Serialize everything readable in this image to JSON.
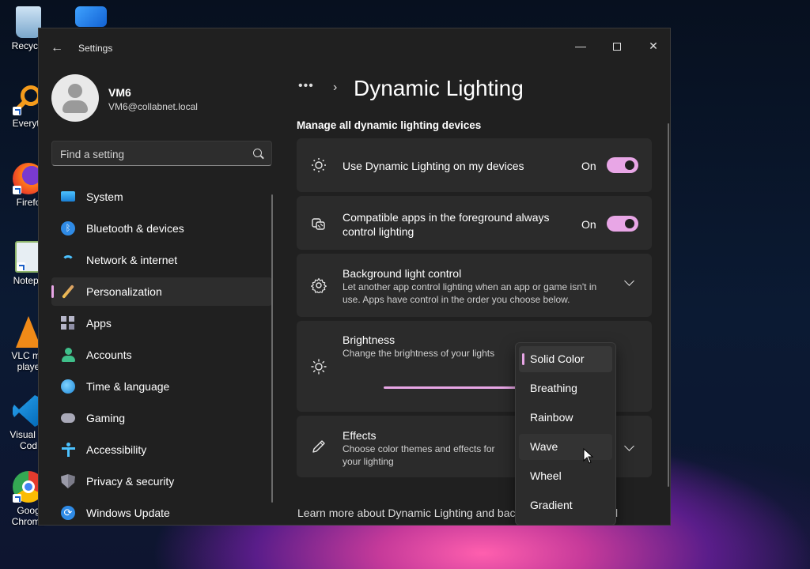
{
  "desktop": {
    "icons": [
      {
        "label": "Recycle",
        "icon": "recycle-bin-icon"
      },
      {
        "label": "Everyth",
        "icon": "everything-search-icon"
      },
      {
        "label": "Firefo",
        "icon": "firefox-icon"
      },
      {
        "label": "Notepa",
        "icon": "notepad-icon"
      },
      {
        "label": "VLC me",
        "label2": "playe",
        "icon": "vlc-icon"
      },
      {
        "label": "Visual St",
        "label2": "Cod",
        "icon": "vscode-icon"
      },
      {
        "label": "Goog",
        "label2": "Chrome",
        "icon": "chrome-icon"
      }
    ]
  },
  "window": {
    "title": "Settings",
    "back_icon": "back-arrow-icon",
    "controls": {
      "minimize": "—",
      "close": "✕"
    }
  },
  "user": {
    "name": "VM6",
    "email": "VM6@collabnet.local"
  },
  "search": {
    "placeholder": "Find a setting",
    "value": ""
  },
  "nav": {
    "items": [
      {
        "label": "System",
        "icon": "system-icon",
        "active": false
      },
      {
        "label": "Bluetooth & devices",
        "icon": "bluetooth-icon",
        "active": false
      },
      {
        "label": "Network & internet",
        "icon": "wifi-icon",
        "active": false
      },
      {
        "label": "Personalization",
        "icon": "paintbrush-icon",
        "active": true
      },
      {
        "label": "Apps",
        "icon": "apps-icon",
        "active": false
      },
      {
        "label": "Accounts",
        "icon": "accounts-icon",
        "active": false
      },
      {
        "label": "Time & language",
        "icon": "globe-clock-icon",
        "active": false
      },
      {
        "label": "Gaming",
        "icon": "gamepad-icon",
        "active": false
      },
      {
        "label": "Accessibility",
        "icon": "accessibility-icon",
        "active": false
      },
      {
        "label": "Privacy & security",
        "icon": "shield-icon",
        "active": false
      },
      {
        "label": "Windows Update",
        "icon": "update-icon",
        "active": false
      }
    ]
  },
  "main": {
    "breadcrumb_more": "•••",
    "breadcrumb_chevron": "›",
    "page_title": "Dynamic Lighting",
    "section_title": "Manage all dynamic lighting devices",
    "cards": {
      "use_lighting": {
        "title": "Use Dynamic Lighting on my devices",
        "state": "On",
        "icon": "sun-dots-icon"
      },
      "compatible_apps": {
        "title_line1": "Compatible apps in the foreground always",
        "title_line2": "control lighting",
        "state": "On",
        "icon": "apps-lighting-icon"
      },
      "background_control": {
        "title": "Background light control",
        "desc_line1": "Let another app control lighting when an app or game isn't in",
        "desc_line2": "use. Apps have control in the order you choose below.",
        "icon": "gear-icon"
      },
      "brightness": {
        "title": "Brightness",
        "desc": "Change the brightness of your lights",
        "icon": "brightness-icon"
      },
      "effects": {
        "title": "Effects",
        "desc_line1": "Choose color themes and effects for",
        "desc_line2": "your lighting",
        "icon": "pen-icon"
      }
    },
    "footer_link": "Learn more about Dynamic Lighting and bac",
    "footer_tail": "l"
  },
  "effects_dropdown": {
    "options": [
      "Solid Color",
      "Breathing",
      "Rainbow",
      "Wave",
      "Wheel",
      "Gradient"
    ],
    "selected": "Solid Color",
    "hovered": "Wave"
  },
  "colors": {
    "accent": "#e8a6e6",
    "window_bg": "#202020",
    "card_bg": "#2b2b2b"
  }
}
